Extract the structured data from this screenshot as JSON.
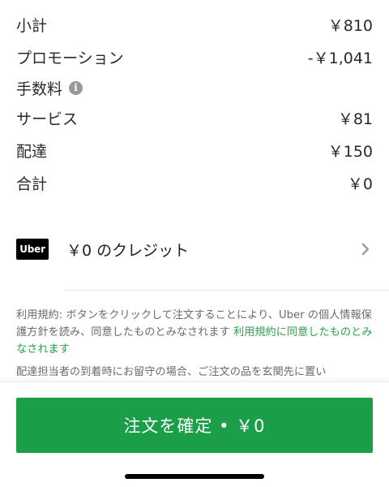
{
  "summary": {
    "subtotal": {
      "label": "小計",
      "value": "￥810"
    },
    "promotion": {
      "label": "プロモーション",
      "value": "-￥1,041"
    },
    "fees": {
      "label": "手数料",
      "info_icon": "info-icon"
    },
    "service": {
      "label": "サービス",
      "value": "￥81"
    },
    "delivery": {
      "label": "配達",
      "value": "￥150"
    },
    "total": {
      "label": "合計",
      "value": "￥0"
    }
  },
  "credit": {
    "logo_text": "Uber",
    "text": "￥0 のクレジット",
    "chevron_icon": "chevron-right-icon"
  },
  "terms": {
    "text": "利用規約: ボタンをクリックして注文することにより、Uber の個人情報保護方針を読み、同意したものとみなされます ",
    "link": "利用規約に同意したものとみなされます"
  },
  "delivery_note": "配達担当者の到着時にお留守の場合、ご注文の品を玄関先に置い",
  "footer": {
    "confirm_button": "注文を確定 • ￥0"
  },
  "colors": {
    "accent_green": "#1a9f48",
    "link_green": "#2e9e4e",
    "logo_black": "#000000"
  }
}
